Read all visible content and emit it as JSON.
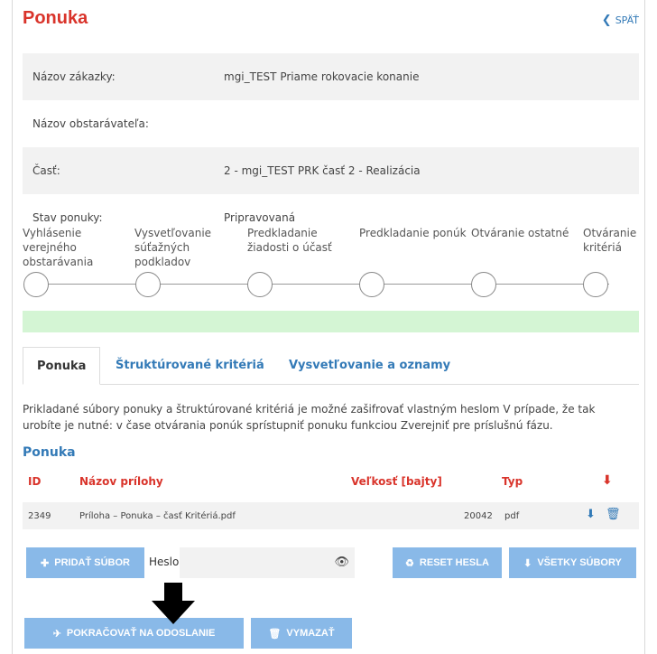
{
  "header": {
    "title": "Ponuka",
    "back_label": "SPÄŤ"
  },
  "info": [
    {
      "label": "Názov zákazky:",
      "value": "mgi_TEST Priame rokovacie konanie"
    },
    {
      "label": "Názov obstarávateľa:",
      "value": ""
    },
    {
      "label": "Časť:",
      "value": "2 - mgi_TEST PRK časť 2 - Realizácia"
    },
    {
      "label": "Stav ponuky:",
      "value": "Pripravovaná"
    }
  ],
  "steps": [
    "Vyhlásenie verejného obstarávania",
    "Vysvetľovanie súťažných podkladov",
    "Predkladanie žiadosti o účasť",
    "Predkladanie ponúk",
    "Otváranie ostatné",
    "Otváranie kritériá"
  ],
  "tabs": [
    "Ponuka",
    "Štruktúrované kritériá",
    "Vysvetľovanie a oznamy"
  ],
  "note": "Prikladané súbory ponuky a štruktúrované kritériá je možné zašifrovať vlastným heslom V prípade, že tak urobíte je nutné: v čase otvárania ponúk sprístupniť ponuku funkciou Zverejniť pre príslušnú fázu.",
  "files": {
    "title": "Ponuka",
    "columns": {
      "id": "ID",
      "name": "Názov prílohy",
      "size": "Veľkosť [bajty]",
      "type": "Typ"
    },
    "rows": [
      {
        "id": "2349",
        "name": "Príloha – Ponuka – časť Kritériá.pdf",
        "size": "20042",
        "type": "pdf"
      }
    ]
  },
  "actions": {
    "add_file": "PRIDAŤ SÚBOR",
    "password_label": "Heslo",
    "password_value": "",
    "reset_password": "RESET HESLA",
    "all_files": "VŠETKY SÚBORY",
    "continue_send": "POKRAČOVAŤ NA ODOSLANIE",
    "delete": "VYMAZAŤ"
  },
  "colors": {
    "accent_red": "#d9342b",
    "link_blue": "#337ab7",
    "button_blue": "#89b9e8",
    "progress_green": "#d4f5d4"
  }
}
